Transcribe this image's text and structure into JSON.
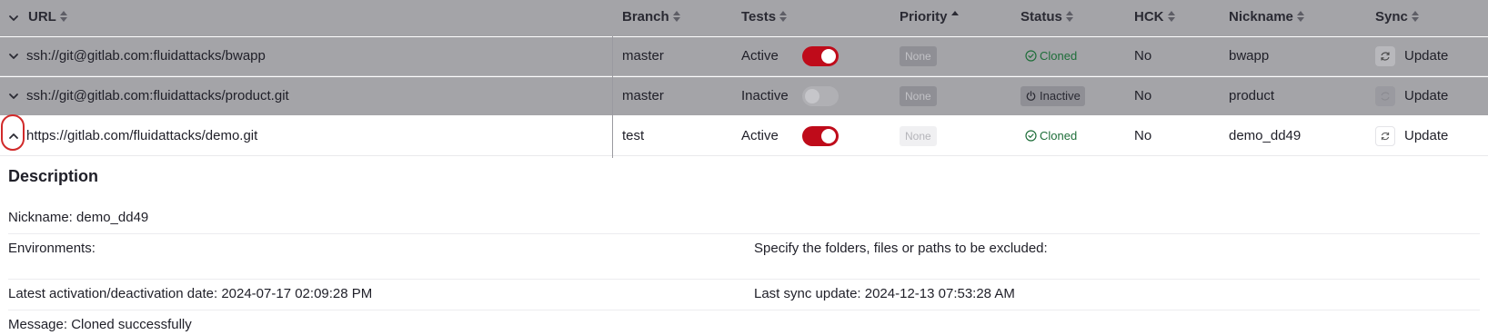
{
  "table": {
    "headers": {
      "url": "URL",
      "branch": "Branch",
      "tests": "Tests",
      "priority": "Priority",
      "status": "Status",
      "hck": "HCK",
      "nickname": "Nickname",
      "sync": "Sync"
    },
    "rows": [
      {
        "url": "ssh://git@gitlab.com:fluidattacks/bwapp",
        "branch": "master",
        "tests": "Active",
        "tests_on": true,
        "priority": "None",
        "status": "Cloned",
        "hck": "No",
        "nickname": "bwapp",
        "sync": "Update"
      },
      {
        "url": "ssh://git@gitlab.com:fluidattacks/product.git",
        "branch": "master",
        "tests": "Inactive",
        "tests_on": false,
        "priority": "None",
        "status": "Inactive",
        "hck": "No",
        "nickname": "product",
        "sync": "Update"
      },
      {
        "url": "https://gitlab.com/fluidattacks/demo.git",
        "branch": "test",
        "tests": "Active",
        "tests_on": true,
        "priority": "None",
        "status": "Cloned",
        "hck": "No",
        "nickname": "demo_dd49",
        "sync": "Update"
      }
    ]
  },
  "details": {
    "title": "Description",
    "nickname": "Nickname: demo_dd49",
    "environments": "Environments:",
    "excluded": "Specify the folders, files or paths to be excluded:",
    "latest_activation": "Latest activation/deactivation date: 2024-07-17 02:09:28 PM",
    "last_sync": "Last sync update: 2024-12-13 07:53:28 AM",
    "message": "Message: Cloned successfully"
  },
  "colors": {
    "header_bg": "#a4a4a8",
    "toggle_on": "#bf0b1a",
    "cloned_green": "#1f6e3a",
    "focus_ring": "#d12a2a"
  },
  "icons": [
    "chevron-down-icon",
    "chevron-up-icon",
    "check-circle-icon",
    "power-icon",
    "refresh-icon",
    "sort-icon",
    "sort-asc-icon"
  ]
}
